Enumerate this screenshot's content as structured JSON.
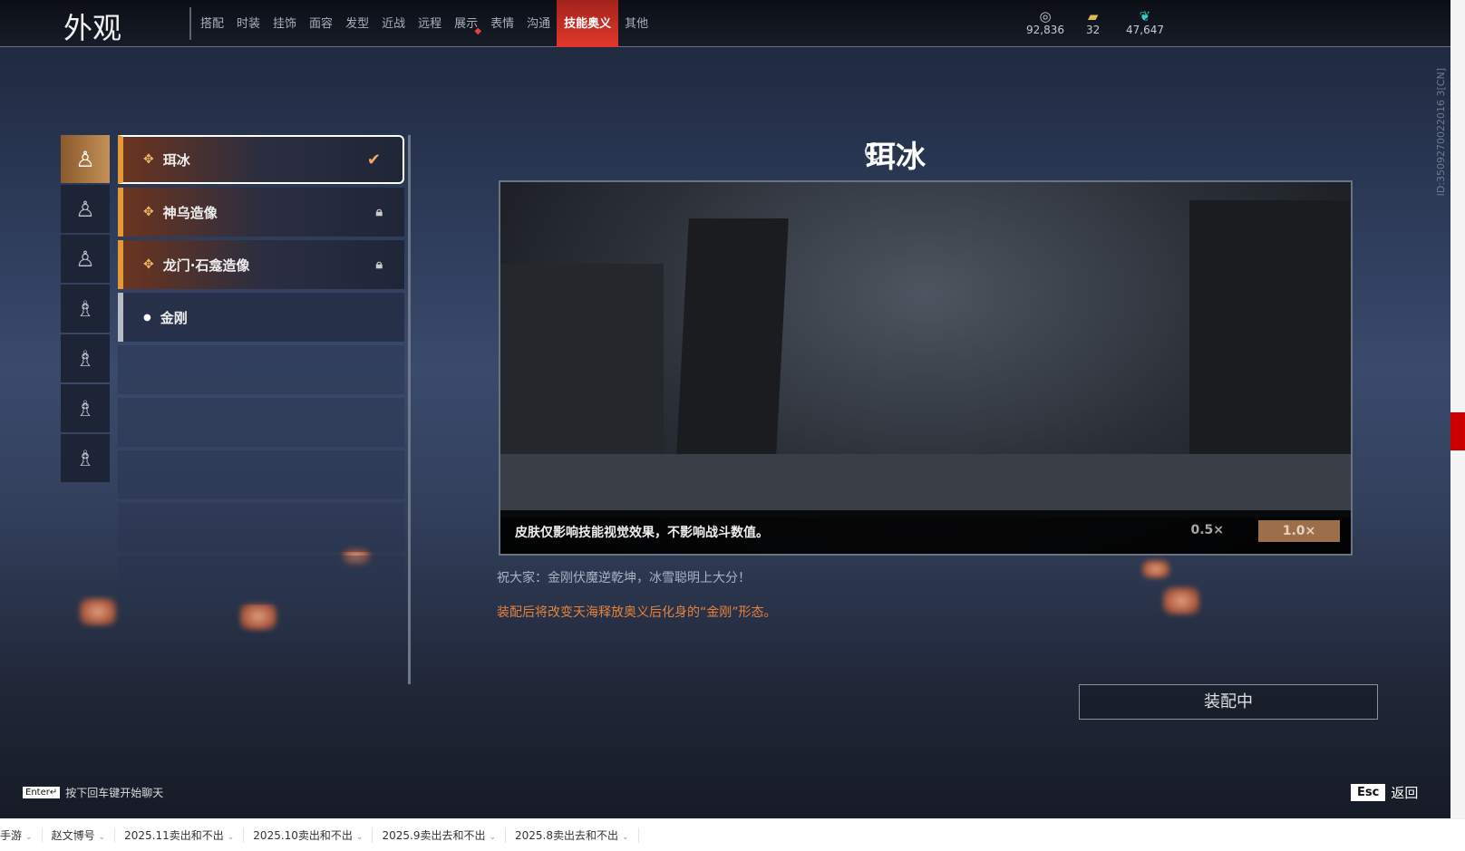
{
  "header": {
    "title": "外观",
    "tabs": [
      {
        "label": "搭配"
      },
      {
        "label": "时装"
      },
      {
        "label": "挂饰"
      },
      {
        "label": "面容"
      },
      {
        "label": "发型"
      },
      {
        "label": "近战"
      },
      {
        "label": "远程"
      },
      {
        "label": "展示",
        "badge": true
      },
      {
        "label": "表情"
      },
      {
        "label": "沟通"
      },
      {
        "label": "技能奥义",
        "active": true
      },
      {
        "label": "其他"
      }
    ]
  },
  "currencies": [
    {
      "icon": "silver-coin-icon",
      "value": "92,836"
    },
    {
      "icon": "gold-ticket-icon",
      "value": "32"
    },
    {
      "icon": "jade-feather-icon",
      "value": "47,647"
    }
  ],
  "id_text": "ID:3509270022016 3[CN]",
  "skins": [
    {
      "name": "珥冰",
      "state": "equipped"
    },
    {
      "name": "神乌造像",
      "state": "locked"
    },
    {
      "name": "龙门·石龛造像",
      "state": "locked"
    },
    {
      "name": "金刚",
      "state": "default"
    }
  ],
  "detail": {
    "title": "珥冰",
    "caption": "皮肤仅影响技能视觉效果，不影响战斗数值。",
    "speed_options": [
      "0.5×",
      "1.0×"
    ],
    "selected_speed": "1.0×",
    "wish": "祝大家：金刚伏魔逆乾坤，冰雪聪明上大分！",
    "note": "装配后将改变天海释放奥义后化身的“金刚”形态。",
    "equip_button": "装配中"
  },
  "footer": {
    "enter_key": "Enter↵",
    "chat_hint": "按下回车键开始聊天",
    "esc_key": "Esc",
    "back": "返回"
  },
  "bookmarks": [
    "手游",
    "赵文博号",
    "2025.11卖出和不出",
    "2025.10卖出和不出",
    "2025.9卖出去和不出",
    "2025.8卖出去和不出"
  ],
  "colors": {
    "accent": "#e2392c",
    "orange": "#e39a34",
    "note": "#e6823c"
  }
}
